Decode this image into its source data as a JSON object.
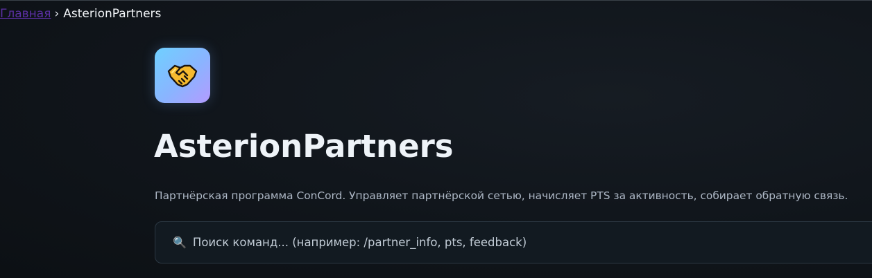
{
  "breadcrumb": {
    "home": "Главная",
    "separator": "›",
    "current": "AsterionPartners"
  },
  "header": {
    "logo_icon": "handshake-icon",
    "title": "AsterionPartners",
    "description": "Партнёрская программа ConCord. Управляет партнёрской сетью, начисляет PTS за активность, собирает обратную связь."
  },
  "search": {
    "icon": "🔍",
    "placeholder": "Поиск команд... (например: /partner_info, pts, feedback)",
    "value": ""
  },
  "colors": {
    "background": "#11161c",
    "link": "#5b2fa3",
    "logo_gradient_start": "#6fd0ff",
    "logo_gradient_end": "#b39bff",
    "handshake": "#f5b82e"
  }
}
